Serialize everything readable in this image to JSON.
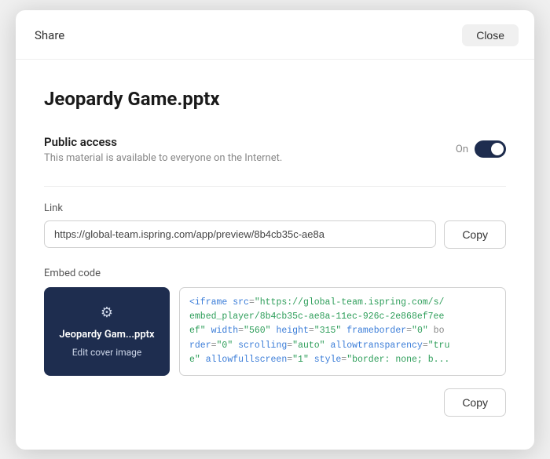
{
  "dialog": {
    "header": {
      "title": "Share",
      "close_label": "Close"
    },
    "file_title": "Jeopardy Game.pptx",
    "public_access": {
      "label": "Public access",
      "description": "This material is available to everyone on the Internet.",
      "toggle_label": "On",
      "toggle_on": true
    },
    "link_section": {
      "label": "Link",
      "value": "https://global-team.ispring.com/app/preview/8b4cb35c-ae8a",
      "placeholder": "https://global-team.ispring.com/app/preview/8b4cb35c-ae8a",
      "copy_label": "Copy"
    },
    "embed_section": {
      "label": "Embed code",
      "cover_title": "Jeopardy Gam...pptx",
      "cover_edit": "Edit cover image",
      "code_snippet": "<iframe src=\"https://global-team.ispring.com/s/embed_player/8b4cb35c-ae8a-11ec-926c-2e868ef7eef\" width=\"560\" height=\"315\" frameborder=\"0\" border=\"0\" scrolling=\"auto\" allowtransparency=\"true\" allowfullscreen=\"1\" style=\"border: none; b...",
      "copy_label": "Copy"
    }
  }
}
